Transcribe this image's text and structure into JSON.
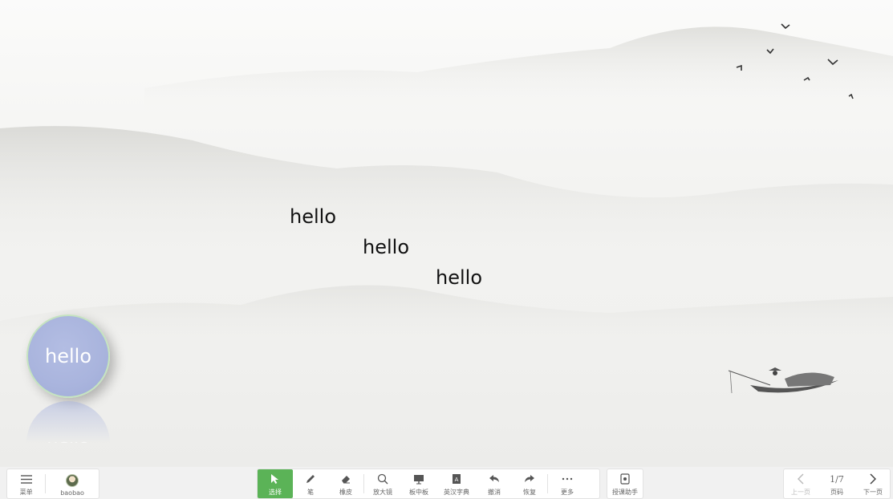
{
  "slide": {
    "texts": [
      "hello",
      "hello",
      "hello"
    ],
    "bubble_text": "hello"
  },
  "toolbar": {
    "left": {
      "menu_label": "菜单",
      "user_name": "baobao"
    },
    "tools": [
      {
        "label": "选择",
        "icon": "cursor-icon",
        "active": true
      },
      {
        "label": "笔",
        "icon": "pen-icon"
      },
      {
        "label": "橡皮",
        "icon": "eraser-icon"
      },
      {
        "label": "放大镜",
        "icon": "magnifier-icon"
      },
      {
        "label": "板中板",
        "icon": "board-icon"
      },
      {
        "label": "英汉字典",
        "icon": "dictionary-icon"
      },
      {
        "label": "撤消",
        "icon": "undo-icon"
      },
      {
        "label": "恢复",
        "icon": "redo-icon"
      },
      {
        "label": "更多",
        "icon": "more-icon"
      }
    ],
    "assistant_label": "授课助手",
    "pager": {
      "prev_label": "上一页",
      "page_indicator": "1/7",
      "page_label": "页码",
      "next_label": "下一页"
    }
  },
  "colors": {
    "active_tool": "#5bb357",
    "bubble": "#a9b4dd"
  }
}
